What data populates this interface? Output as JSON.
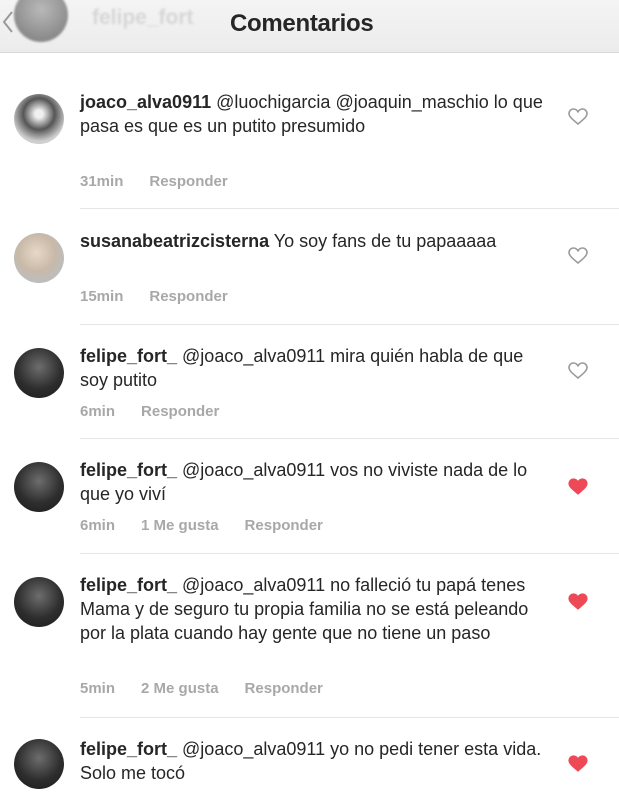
{
  "header": {
    "ghost_username": "felipe_fort",
    "title": "Comentarios"
  },
  "comments": [
    {
      "username": "joaco_alva0911",
      "text": " @luochigarcia @joaquin_maschio lo que pasa es que es un putito presumido",
      "time": "31min",
      "likes": "",
      "reply": "Responder",
      "liked": false
    },
    {
      "username": "susanabeatrizcisterna",
      "text": " Yo soy fans de tu papaaaaa",
      "time": "15min",
      "likes": "",
      "reply": "Responder",
      "liked": false
    },
    {
      "username": "felipe_fort_",
      "text": " @joaco_alva0911 mira quién habla de que soy putito",
      "time": "6min",
      "likes": "",
      "reply": "Responder",
      "liked": false
    },
    {
      "username": "felipe_fort_",
      "text": " @joaco_alva0911 vos no viviste nada de lo que yo viví",
      "time": "6min",
      "likes": "1 Me gusta",
      "reply": "Responder",
      "liked": true
    },
    {
      "username": "felipe_fort_",
      "text": " @joaco_alva0911 no falleció tu papá tenes Mama y de seguro tu propia familia no se está peleando por la plata cuando hay gente que no tiene un paso",
      "time": "5min",
      "likes": "2 Me gusta",
      "reply": "Responder",
      "liked": true
    },
    {
      "username": "felipe_fort_",
      "text": " @joaco_alva0911 yo no pedi tener esta vida. Solo me tocó",
      "time": "",
      "likes": "",
      "reply": "",
      "liked": true
    }
  ],
  "colors": {
    "heart_liked": "#ed4956",
    "heart_outline": "#9a9a9a"
  }
}
